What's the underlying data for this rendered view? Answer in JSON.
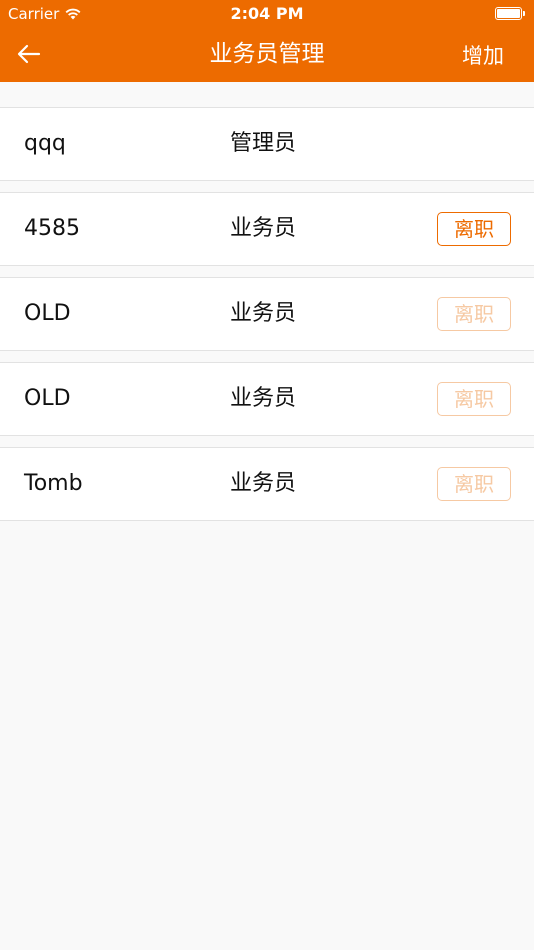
{
  "status_bar": {
    "carrier": "Carrier",
    "time": "2:04 PM"
  },
  "nav": {
    "title": "业务员管理",
    "add_label": "增加"
  },
  "colors": {
    "accent": "#ed6b00",
    "disabled": "#f6c9a3",
    "background": "#f9f9f9"
  },
  "rows": [
    {
      "name": "qqq",
      "role": "管理员",
      "action": ""
    },
    {
      "name": "4585",
      "role": "业务员",
      "action": "离职"
    },
    {
      "name": "OLD",
      "role": "业务员",
      "action": "离职"
    },
    {
      "name": "OLD",
      "role": "业务员",
      "action": "离职"
    },
    {
      "name": "Tomb",
      "role": "业务员",
      "action": "离职"
    }
  ]
}
